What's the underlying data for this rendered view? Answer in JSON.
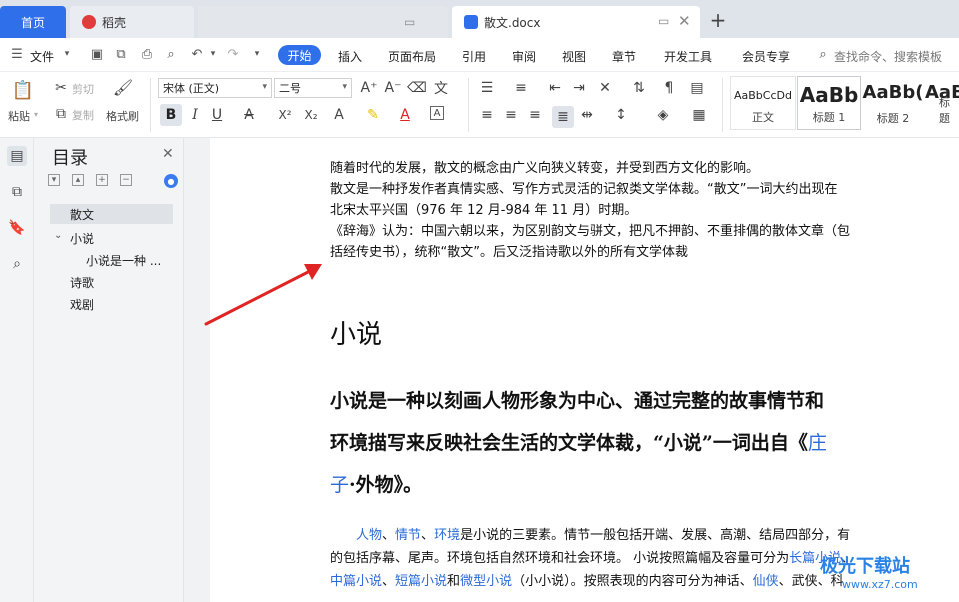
{
  "tabs": {
    "home": "首页",
    "daoke": "稻壳",
    "blank": "",
    "doc": "散文.docx",
    "new_tab": "+"
  },
  "menu": {
    "file": "文件",
    "start": "开始",
    "insert": "插入",
    "layout": "页面布局",
    "reference": "引用",
    "review": "审阅",
    "view": "视图",
    "section": "章节",
    "dev": "开发工具",
    "member": "会员专享",
    "search": "查找命令、搜索模板"
  },
  "ribbon": {
    "paste": "粘贴",
    "cut": "剪切",
    "copy": "复制",
    "format_painter": "格式刷",
    "font_name": "宋体 (正文)",
    "font_size": "二号",
    "bold": "B",
    "italic": "I",
    "underline": "U",
    "superscript": "X²",
    "subscript": "X₂",
    "styles": [
      {
        "preview": "AaBbCcDd",
        "name": "正文"
      },
      {
        "preview": "AaBb",
        "name": "标题 1"
      },
      {
        "preview": "AaBb(",
        "name": "标题 2"
      },
      {
        "preview": "AaB",
        "name": "标题"
      }
    ]
  },
  "toc": {
    "title": "目录",
    "items": [
      "散文",
      "小说",
      "小说是一种 ...",
      "诗歌",
      "戏剧"
    ]
  },
  "doc": {
    "lines": [
      "随着时代的发展，散文的概念由广义向狭义转变，并受到西方文化的影响。",
      "散文是一种抒发作者真情实感、写作方式灵活的记叙类文学体裁。“散文”一词大约出现在",
      "北宋太平兴国（976 年 12 月-984 年 11 月）时期。",
      "《辞海》认为：中国六朝以来，为区别韵文与骈文，把凡不押韵、不重排偶的散体文章（包",
      "括经传史书），统称“散文”。后又泛指诗歌以外的所有文学体裁"
    ],
    "heading": "小说",
    "bold_para_1": "小说是一种以刻画人物形象为中心、通过完整的故事情节和",
    "bold_para_2": "环境描写来反映社会生活的文学体裁，“小说”一词出自《",
    "bold_para_link": "庄",
    "bold_para_3_link": "子",
    "bold_para_3": "·外物》。",
    "p2": {
      "l1_links": [
        "人物",
        "情节",
        "环境"
      ],
      "l1_sep": "、",
      "l1_rest": "是小说的三要素。情节一般包括开端、发展、高潮、结局四部分，有",
      "l2_a": "的包括序幕、尾声。环境包括自然环境和社会环境。 小说按照篇幅及容量可分为",
      "l2_link": "长篇小说",
      "l2_b": "、",
      "l3_link1": "中篇小说",
      "l3_sep": "、",
      "l3_link2": "短篇小说",
      "l3_and": "和",
      "l3_link3": "微型小说",
      "l3_rest": "（小小说）。按照表现的内容可分为神话、",
      "l3_link4": "仙侠",
      "l3_tail": "、武侠、科"
    }
  },
  "watermark": {
    "title": "极光下载站",
    "url": "www.xz7.com"
  },
  "colors": {
    "accent": "#2f6fea",
    "link": "#2b6bd8",
    "arrow": "#e02424"
  }
}
